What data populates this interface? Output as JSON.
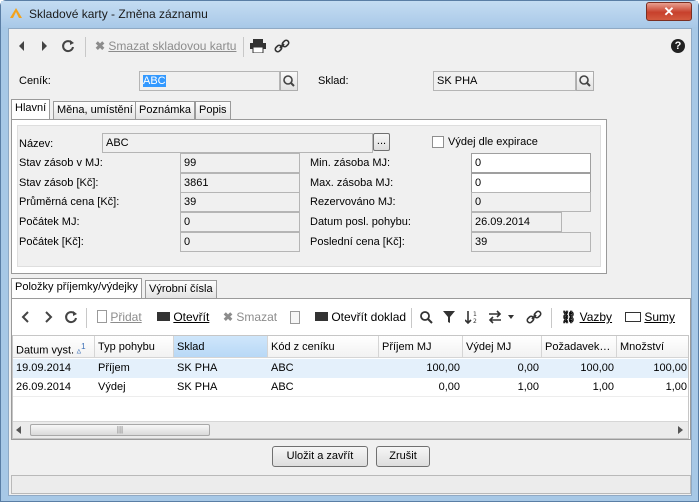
{
  "window": {
    "title": "Skladové karty - Změna záznamu",
    "close_label": "✕"
  },
  "toolbar": {
    "delete_label": "Smazat skladovou kartu"
  },
  "header_fields": {
    "cenik_label": "Ceník:",
    "cenik_value": "ABC",
    "sklad_label": "Sklad:",
    "sklad_value": "SK PHA"
  },
  "tabs": [
    {
      "label": "Hlavní"
    },
    {
      "label": "Měna, umístění"
    },
    {
      "label": "Poznámka"
    },
    {
      "label": "Popis"
    }
  ],
  "main": {
    "nazev_label": "Název:",
    "nazev_value": "ABC",
    "ellipsis_label": "...",
    "vydej_label": "Výdej dle expirace",
    "stav_mj_label": "Stav zásob v MJ:",
    "stav_mj_value": "99",
    "stav_kc_label": "Stav zásob [Kč]:",
    "stav_kc_value": "3861",
    "prumerna_label": "Průměrná cena [Kč]:",
    "prumerna_value": "39",
    "pocatek_mj_label": "Počátek MJ:",
    "pocatek_mj_value": "0",
    "pocatek_kc_label": "Počátek [Kč]:",
    "pocatek_kc_value": "0",
    "min_label": "Min. zásoba MJ:",
    "min_value": "0",
    "max_label": "Max. zásoba MJ:",
    "max_value": "0",
    "rez_label": "Rezervováno MJ:",
    "rez_value": "0",
    "datum_label": "Datum posl. pohybu:",
    "datum_value": "26.09.2014",
    "posledni_label": "Poslední cena [Kč]:",
    "posledni_value": "39"
  },
  "bottom_tabs": [
    {
      "label": "Položky příjemky/výdejky"
    },
    {
      "label": "Výrobní čísla"
    }
  ],
  "grid_toolbar": {
    "pridat": "Přidat",
    "otevrit": "Otevřít",
    "smazat": "Smazat",
    "otevrit_doklad": "Otevřít doklad",
    "vazby": "Vazby",
    "sumy": "Sumy"
  },
  "grid": {
    "sort_indicator": "1",
    "columns": [
      "Datum vyst.",
      "Typ pohybu",
      "Sklad",
      "Kód z ceníku",
      "Příjem MJ",
      "Výdej MJ",
      "Požadavek…",
      "Množství"
    ],
    "rows": [
      [
        "19.09.2014",
        "Příjem",
        "SK PHA",
        "ABC",
        "100,00",
        "0,00",
        "100,00",
        "100,00"
      ],
      [
        "26.09.2014",
        "Výdej",
        "SK PHA",
        "ABC",
        "0,00",
        "1,00",
        "1,00",
        "1,00"
      ]
    ]
  },
  "buttons": {
    "save": "Uložit a zavřít",
    "cancel": "Zrušit"
  }
}
